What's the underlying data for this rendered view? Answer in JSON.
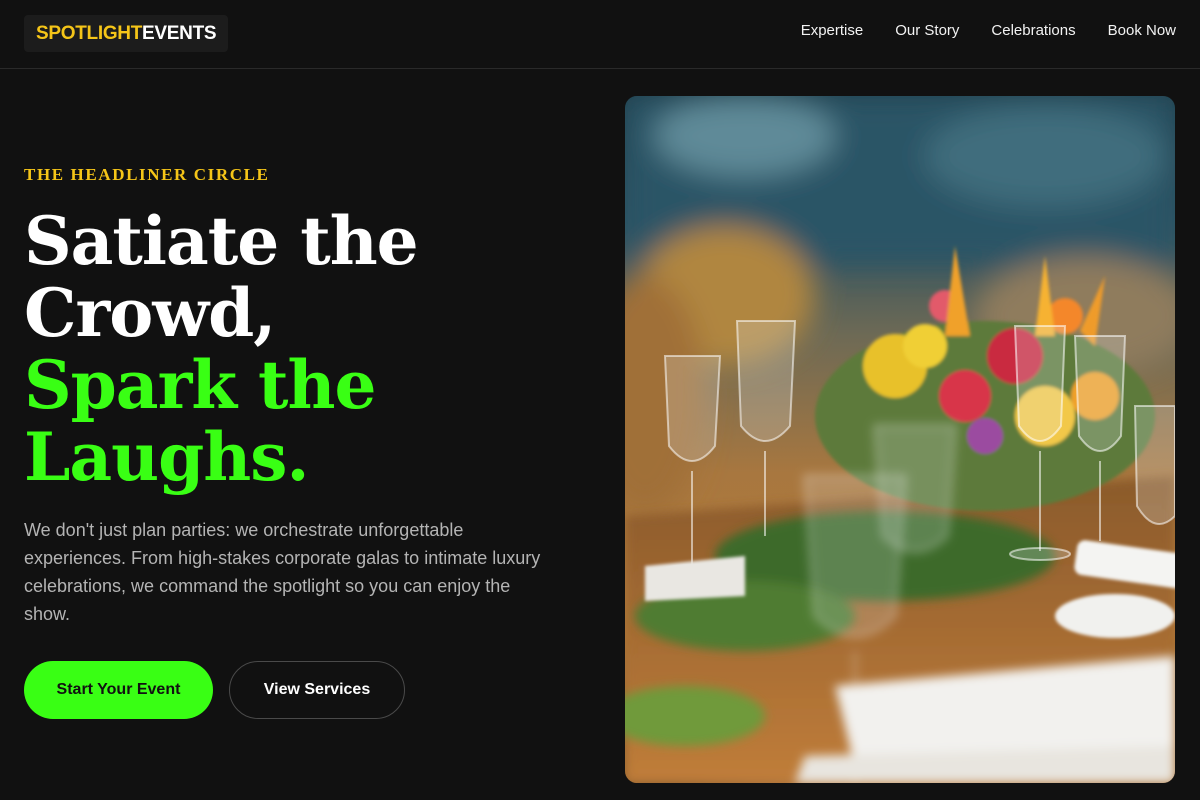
{
  "brand": {
    "part1": "SPOTLIGHT",
    "part2": "EVENTS",
    "accent_color": "#f5c518"
  },
  "nav": {
    "items": [
      {
        "label": "Expertise"
      },
      {
        "label": "Our Story"
      },
      {
        "label": "Celebrations"
      },
      {
        "label": "Book Now"
      }
    ]
  },
  "hero": {
    "eyebrow": "THE HEADLINER CIRCLE",
    "headline_line1": "Satiate the",
    "headline_line2": "Crowd,",
    "headline_line3": "Spark the",
    "headline_line4": "Laughs.",
    "description": "We don't just plan parties: we orchestrate unforgettable experiences. From high-stakes corporate galas to intimate luxury celebrations, we command the spotlight so you can enjoy the show.",
    "primary_cta": "Start Your Event",
    "secondary_cta": "View Services",
    "image_alt": "Banquet table with floral centerpiece and wine glasses",
    "highlight_color": "#39ff14",
    "background_color": "#111111"
  }
}
